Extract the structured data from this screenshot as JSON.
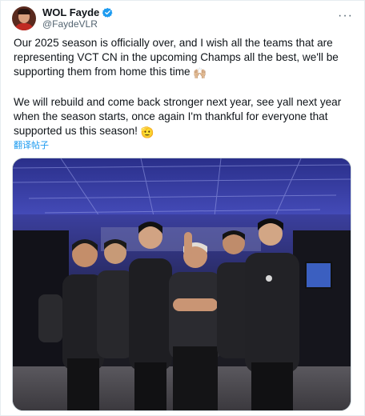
{
  "user": {
    "display_name": "WOL Fayde",
    "handle": "@FaydeVLR",
    "verified": true
  },
  "tweet": {
    "paragraph_1": "Our 2025 season is officially over, and I wish all the teams that are representing VCT CN in the upcoming Champs all the best, we'll be supporting them from home this time",
    "emoji_1": "🙌🏼",
    "paragraph_2": "We will rebuild and come back stronger next year, see yall next year when the season starts, once again I'm thankful for everyone that supported us this season!",
    "emoji_2": "🫡",
    "translate_label": "翻译帖子"
  },
  "media": {
    "description_icon": "team-photo"
  },
  "icons": {
    "more": "more-icon",
    "verified": "verified-badge-icon"
  },
  "colors": {
    "link": "#1d9bf0",
    "verified": "#1d9bf0",
    "secondary_text": "#536471"
  }
}
